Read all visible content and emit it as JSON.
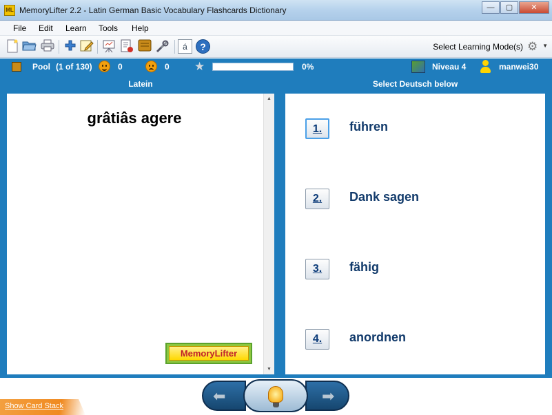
{
  "window": {
    "app_icon": "ML",
    "title": "MemoryLifter 2.2 - Latin German Basic Vocabulary Flashcards Dictionary",
    "minimize": "—",
    "maximize": "▢",
    "close": "✕"
  },
  "menu": [
    "File",
    "Edit",
    "Learn",
    "Tools",
    "Help"
  ],
  "toolbar": {
    "icons": [
      "new-document-icon",
      "open-folder-icon",
      "print-icon",
      "add-card-icon",
      "edit-card-icon",
      "presentation-icon",
      "statistics-icon",
      "card-box-icon",
      "settings-tools-icon",
      "special-char-icon",
      "help-icon"
    ],
    "special_char": "á",
    "help": "?",
    "mode_label": "Select Learning Mode(s)"
  },
  "status": {
    "pool_label": "Pool",
    "pool_count": "(1 of 130)",
    "correct_count": "0",
    "wrong_count": "0",
    "progress_percent": 0,
    "progress_text": "0%",
    "level": "Niveau 4",
    "user": "manwei30"
  },
  "left_pane": {
    "header": "Latein",
    "question": "grâtiâs agere",
    "logo_text_memory": "Memory",
    "logo_text_lifter": "Lifter"
  },
  "right_pane": {
    "header": "Select Deutsch below",
    "answers": [
      {
        "number": "1.",
        "text": "führen"
      },
      {
        "number": "2.",
        "text": "Dank sagen"
      },
      {
        "number": "3.",
        "text": "fähig"
      },
      {
        "number": "4.",
        "text": "anordnen"
      }
    ]
  },
  "bottom": {
    "show_card_stack": "Show Card Stack"
  },
  "colors": {
    "accent_blue": "#1f7dbd",
    "answer_text": "#113a6b"
  }
}
